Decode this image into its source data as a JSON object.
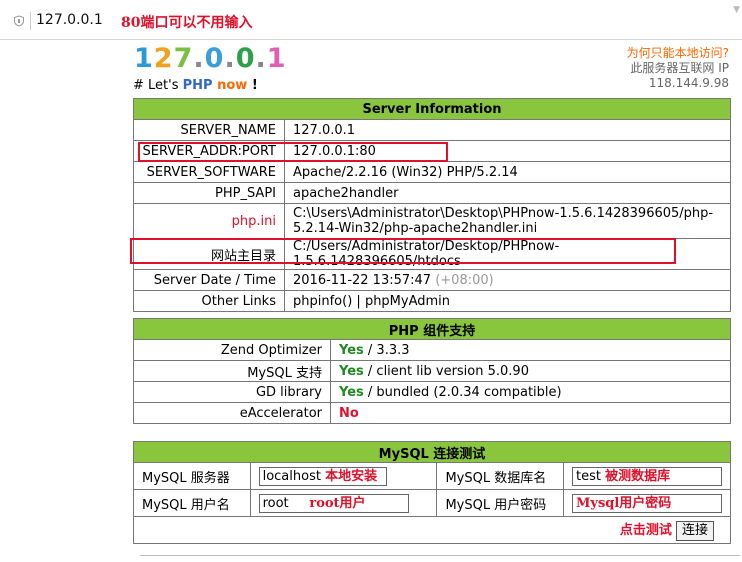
{
  "address_bar": {
    "url": "127.0.0.1",
    "annotation": "80端口可以不用输入"
  },
  "logo": {
    "chars": [
      "1",
      "2",
      "7",
      ".",
      "0",
      ".",
      "0",
      ".",
      "1"
    ],
    "colors": [
      "#2a9ad6",
      "#f2a020",
      "#7ac043",
      "#888888",
      "#3b9ed9",
      "#888888",
      "#2fa04a",
      "#888888",
      "#e05fb0"
    ]
  },
  "tagline": {
    "prefix": "# Let's ",
    "php": "PHP",
    "now": "now",
    "suffix": "!"
  },
  "remote": {
    "question": "为何只能本地访问?",
    "note": "此服务器互联网 IP",
    "ip": "118.144.9.98"
  },
  "server_info": {
    "title": "Server Information",
    "rows": [
      {
        "key": "SERVER_NAME",
        "value": "127.0.0.1"
      },
      {
        "key": "SERVER_ADDR:PORT",
        "value": "127.0.0.1:80"
      },
      {
        "key": "SERVER_SOFTWARE",
        "value": "Apache/2.2.16 (Win32) PHP/5.2.14"
      },
      {
        "key": "PHP_SAPI",
        "value": "apache2handler"
      },
      {
        "key": "php.ini",
        "value_line1": "C:\\Users\\Administrator\\Desktop\\PHPnow-1.5.6.1428396605/php-",
        "value_line2": "5.2.14-Win32/php-apache2handler.ini"
      },
      {
        "key": "网站主目录",
        "value": "C:/Users/Administrator/Desktop/PHPnow-1.5.6.1428396605/htdocs"
      },
      {
        "key": "Server Date / Time",
        "value": "2016-11-22 13:57:47",
        "extra": "(+08:00)"
      },
      {
        "key": "Other Links",
        "link1": "phpinfo()",
        "separator": " | ",
        "link2": "phpMyAdmin"
      }
    ]
  },
  "php_components": {
    "title": "PHP 组件支持",
    "rows": [
      {
        "key": "Zend Optimizer",
        "status": "Yes",
        "detail": " / 3.3.3"
      },
      {
        "key": "MySQL 支持",
        "status": "Yes",
        "detail": " / client lib version 5.0.90"
      },
      {
        "key": "GD library",
        "status": "Yes",
        "detail": " / bundled (2.0.34 compatible)"
      },
      {
        "key": "eAccelerator",
        "status": "No",
        "detail": ""
      }
    ]
  },
  "mysql_test": {
    "title": "MySQL 连接测试",
    "server_label": "MySQL 服务器",
    "server_value": "localhost",
    "server_note": "本地安装",
    "db_label": "MySQL 数据库名",
    "db_value": "test",
    "db_note": "被测数据库",
    "user_label": "MySQL 用户名",
    "user_value": "root",
    "user_note": "root用户",
    "pass_label": "MySQL 用户密码",
    "pass_note": "Mysql用户密码",
    "click_note": "点击测试",
    "connect_button": "连接"
  }
}
